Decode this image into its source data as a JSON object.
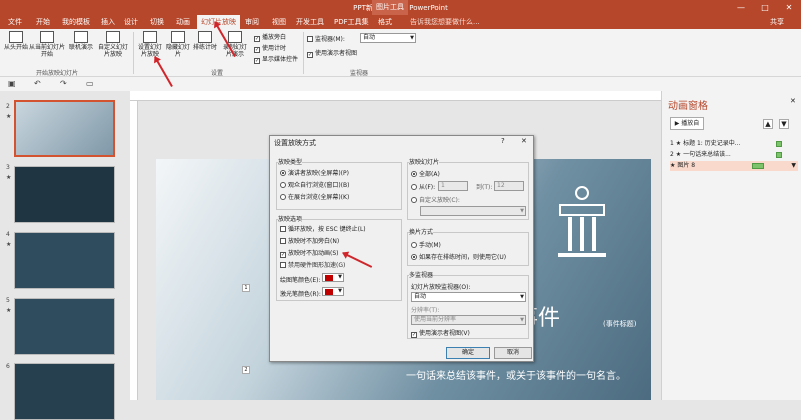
{
  "window": {
    "title": "PPT新建2.pptx - PowerPoint",
    "picture_tools": "图片工具",
    "min": "—",
    "restore": "□",
    "close": "✕"
  },
  "tabs": [
    "文件",
    "开始",
    "我的模板",
    "插入",
    "设计",
    "切换",
    "动画",
    "幻灯片放映",
    "审阅",
    "视图",
    "开发工具",
    "PDF工具集",
    "格式"
  ],
  "active_tab": "幻灯片放映",
  "tell_me": "告诉我您想要做什么...",
  "share": "共享",
  "ribbon": {
    "from_start": "从头开始",
    "from_current": "从当前幻灯片开始",
    "online": "联机演示",
    "custom": "自定义幻灯片放映",
    "group_start": "开始放映幻灯片",
    "setup": "设置幻灯片放映",
    "hide": "隐藏幻灯片",
    "rehearse": "排练计时",
    "record": "录制幻灯片演示",
    "chk_narration": "播放旁白",
    "chk_timings": "使用计时",
    "chk_media": "显示媒体控件",
    "group_setup": "设置",
    "monitor_label": "监视器(M):",
    "monitor_value": "自动",
    "presenter": "使用演示者视图",
    "group_monitor": "监视器"
  },
  "thumbs": [
    {
      "num": "2",
      "star": "★"
    },
    {
      "num": "3",
      "star": "★"
    },
    {
      "num": "4",
      "star": "★"
    },
    {
      "num": "5",
      "star": "★"
    },
    {
      "num": "6",
      "star": ""
    }
  ],
  "slide": {
    "title": "名事件",
    "tag": "(事件标题)",
    "subtitle": "一句话来总结该事件，或关于该事件的一句名言。",
    "marker1": "1",
    "marker2": "2"
  },
  "pane": {
    "title": "动画窗格",
    "play": "▶ 播放自",
    "items": [
      {
        "num": "1",
        "text": "标题 1: 历史记录中..."
      },
      {
        "num": "2",
        "text": "一句话来总结该..."
      },
      {
        "num": "",
        "text": "图片 8"
      }
    ]
  },
  "dialog": {
    "title": "设置放映方式",
    "help": "?",
    "close": "✕",
    "type_group": "放映类型",
    "type_1": "演讲者放映(全屏幕)(P)",
    "type_2": "观众自行浏览(窗口)(B)",
    "type_3": "在展台浏览(全屏幕)(K)",
    "options_group": "放映选项",
    "opt_loop": "循环放映，按 ESC 键终止(L)",
    "opt_no_narration": "放映时不加旁白(N)",
    "opt_no_animation": "放映时不加动画(S)",
    "opt_no_hw": "禁用硬件图形加速(G)",
    "pen_color": "绘图笔颜色(E):",
    "laser_color": "激光笔颜色(R):",
    "slides_group": "放映幻灯片",
    "slides_all": "全部(A)",
    "slides_from": "从(F):",
    "from_value": "1",
    "to_label": "到(T):",
    "to_value": "12",
    "slides_custom": "自定义放映(C):",
    "advance_group": "换片方式",
    "adv_manual": "手动(M)",
    "adv_timings": "如果存在排练时间，则使用它(U)",
    "monitors_group": "多监视器",
    "monitor_label": "幻灯片放映监视器(O):",
    "monitor_value": "自动",
    "resolution_label": "分辨率(T):",
    "resolution_value": "使用当前分辨率",
    "presenter": "使用演示者视图(V)",
    "ok": "确定",
    "cancel": "取消"
  },
  "accent": "#b7472a",
  "annotation_color": "#d0262b"
}
